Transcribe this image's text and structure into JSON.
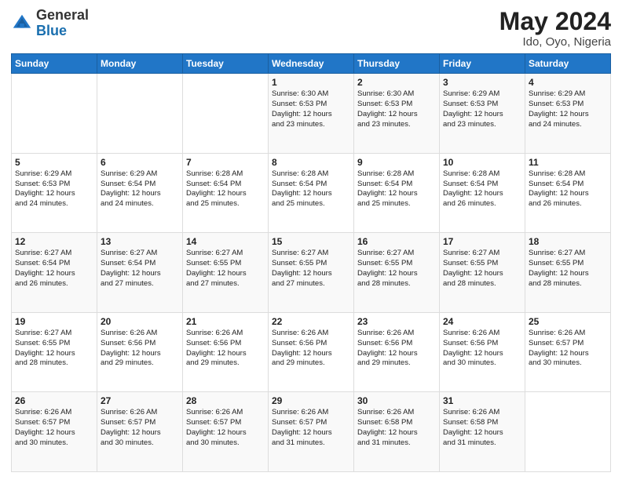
{
  "header": {
    "logo": {
      "general": "General",
      "blue": "Blue"
    },
    "title": "May 2024",
    "location": "Ido, Oyo, Nigeria"
  },
  "days_of_week": [
    "Sunday",
    "Monday",
    "Tuesday",
    "Wednesday",
    "Thursday",
    "Friday",
    "Saturday"
  ],
  "weeks": [
    [
      {
        "day": "",
        "info": ""
      },
      {
        "day": "",
        "info": ""
      },
      {
        "day": "",
        "info": ""
      },
      {
        "day": "1",
        "info": "Sunrise: 6:30 AM\nSunset: 6:53 PM\nDaylight: 12 hours\nand 23 minutes."
      },
      {
        "day": "2",
        "info": "Sunrise: 6:30 AM\nSunset: 6:53 PM\nDaylight: 12 hours\nand 23 minutes."
      },
      {
        "day": "3",
        "info": "Sunrise: 6:29 AM\nSunset: 6:53 PM\nDaylight: 12 hours\nand 23 minutes."
      },
      {
        "day": "4",
        "info": "Sunrise: 6:29 AM\nSunset: 6:53 PM\nDaylight: 12 hours\nand 24 minutes."
      }
    ],
    [
      {
        "day": "5",
        "info": "Sunrise: 6:29 AM\nSunset: 6:53 PM\nDaylight: 12 hours\nand 24 minutes."
      },
      {
        "day": "6",
        "info": "Sunrise: 6:29 AM\nSunset: 6:54 PM\nDaylight: 12 hours\nand 24 minutes."
      },
      {
        "day": "7",
        "info": "Sunrise: 6:28 AM\nSunset: 6:54 PM\nDaylight: 12 hours\nand 25 minutes."
      },
      {
        "day": "8",
        "info": "Sunrise: 6:28 AM\nSunset: 6:54 PM\nDaylight: 12 hours\nand 25 minutes."
      },
      {
        "day": "9",
        "info": "Sunrise: 6:28 AM\nSunset: 6:54 PM\nDaylight: 12 hours\nand 25 minutes."
      },
      {
        "day": "10",
        "info": "Sunrise: 6:28 AM\nSunset: 6:54 PM\nDaylight: 12 hours\nand 26 minutes."
      },
      {
        "day": "11",
        "info": "Sunrise: 6:28 AM\nSunset: 6:54 PM\nDaylight: 12 hours\nand 26 minutes."
      }
    ],
    [
      {
        "day": "12",
        "info": "Sunrise: 6:27 AM\nSunset: 6:54 PM\nDaylight: 12 hours\nand 26 minutes."
      },
      {
        "day": "13",
        "info": "Sunrise: 6:27 AM\nSunset: 6:54 PM\nDaylight: 12 hours\nand 27 minutes."
      },
      {
        "day": "14",
        "info": "Sunrise: 6:27 AM\nSunset: 6:55 PM\nDaylight: 12 hours\nand 27 minutes."
      },
      {
        "day": "15",
        "info": "Sunrise: 6:27 AM\nSunset: 6:55 PM\nDaylight: 12 hours\nand 27 minutes."
      },
      {
        "day": "16",
        "info": "Sunrise: 6:27 AM\nSunset: 6:55 PM\nDaylight: 12 hours\nand 28 minutes."
      },
      {
        "day": "17",
        "info": "Sunrise: 6:27 AM\nSunset: 6:55 PM\nDaylight: 12 hours\nand 28 minutes."
      },
      {
        "day": "18",
        "info": "Sunrise: 6:27 AM\nSunset: 6:55 PM\nDaylight: 12 hours\nand 28 minutes."
      }
    ],
    [
      {
        "day": "19",
        "info": "Sunrise: 6:27 AM\nSunset: 6:55 PM\nDaylight: 12 hours\nand 28 minutes."
      },
      {
        "day": "20",
        "info": "Sunrise: 6:26 AM\nSunset: 6:56 PM\nDaylight: 12 hours\nand 29 minutes."
      },
      {
        "day": "21",
        "info": "Sunrise: 6:26 AM\nSunset: 6:56 PM\nDaylight: 12 hours\nand 29 minutes."
      },
      {
        "day": "22",
        "info": "Sunrise: 6:26 AM\nSunset: 6:56 PM\nDaylight: 12 hours\nand 29 minutes."
      },
      {
        "day": "23",
        "info": "Sunrise: 6:26 AM\nSunset: 6:56 PM\nDaylight: 12 hours\nand 29 minutes."
      },
      {
        "day": "24",
        "info": "Sunrise: 6:26 AM\nSunset: 6:56 PM\nDaylight: 12 hours\nand 30 minutes."
      },
      {
        "day": "25",
        "info": "Sunrise: 6:26 AM\nSunset: 6:57 PM\nDaylight: 12 hours\nand 30 minutes."
      }
    ],
    [
      {
        "day": "26",
        "info": "Sunrise: 6:26 AM\nSunset: 6:57 PM\nDaylight: 12 hours\nand 30 minutes."
      },
      {
        "day": "27",
        "info": "Sunrise: 6:26 AM\nSunset: 6:57 PM\nDaylight: 12 hours\nand 30 minutes."
      },
      {
        "day": "28",
        "info": "Sunrise: 6:26 AM\nSunset: 6:57 PM\nDaylight: 12 hours\nand 30 minutes."
      },
      {
        "day": "29",
        "info": "Sunrise: 6:26 AM\nSunset: 6:57 PM\nDaylight: 12 hours\nand 31 minutes."
      },
      {
        "day": "30",
        "info": "Sunrise: 6:26 AM\nSunset: 6:58 PM\nDaylight: 12 hours\nand 31 minutes."
      },
      {
        "day": "31",
        "info": "Sunrise: 6:26 AM\nSunset: 6:58 PM\nDaylight: 12 hours\nand 31 minutes."
      },
      {
        "day": "",
        "info": ""
      }
    ]
  ]
}
